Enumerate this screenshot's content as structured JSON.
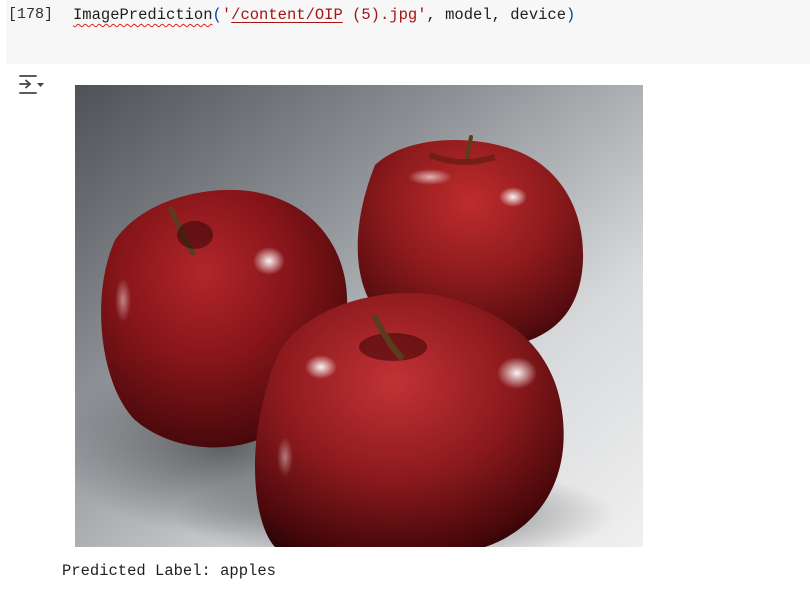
{
  "cell": {
    "execution_count": "[178]",
    "code": {
      "function_name": "ImagePrediction",
      "open_paren": "(",
      "quote_open": "'",
      "path_underlined": "/content/OIP",
      "path_rest": " (5).jpg",
      "quote_close": "'",
      "args_rest": ", model, device",
      "close_paren": ")"
    }
  },
  "output": {
    "toggle_icon": "output-collapse-icon",
    "image_subject": "three red apples",
    "text": "Predicted Label: apples"
  },
  "colors": {
    "cell_background": "#f7f7f7",
    "string": "#a31515",
    "paren": "#0b3fa8",
    "squiggle": "#e2241b"
  }
}
